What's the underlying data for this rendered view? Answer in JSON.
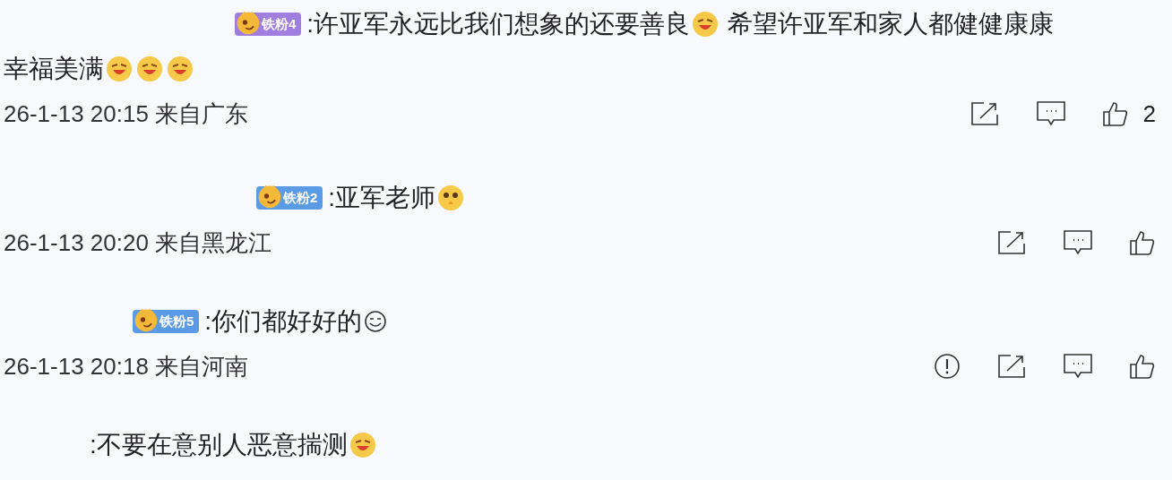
{
  "comments": [
    {
      "badge": {
        "text": "铁粉4",
        "color": "#a07ee0"
      },
      "lines": [
        [
          {
            "kind": "text",
            "text": ":许亚军永远比我们想象的还要善良"
          },
          {
            "kind": "emoji"
          },
          {
            "kind": "text",
            "text": "希望许亚军和家人都健健康康"
          }
        ],
        [
          {
            "kind": "text",
            "text": "幸福美满"
          },
          {
            "kind": "emoji"
          },
          {
            "kind": "emoji"
          },
          {
            "kind": "emoji"
          }
        ]
      ],
      "meta": "26-1-13 20:15 来自广东",
      "actions": [
        {
          "kind": "share"
        },
        {
          "kind": "comment"
        },
        {
          "kind": "like",
          "count": "2"
        }
      ]
    },
    {
      "badge": {
        "text": "铁粉2",
        "color": "#5b9be6"
      },
      "lines": [
        [
          {
            "kind": "text",
            "text": ":亚军老师"
          },
          {
            "kind": "emoji_pray"
          }
        ]
      ],
      "meta": "26-1-13 20:20 来自黑龙江",
      "actions": [
        {
          "kind": "share"
        },
        {
          "kind": "comment"
        },
        {
          "kind": "like"
        }
      ]
    },
    {
      "badge": {
        "text": "铁粉5",
        "color": "#5b9be6"
      },
      "lines": [
        [
          {
            "kind": "text",
            "text": ":你们都好好的"
          },
          {
            "kind": "emoji_smile"
          }
        ]
      ],
      "meta": "26-1-13 20:18 来自河南",
      "actions": [
        {
          "kind": "report"
        },
        {
          "kind": "share"
        },
        {
          "kind": "comment"
        },
        {
          "kind": "like"
        }
      ]
    },
    {
      "lines": [
        [
          {
            "kind": "text",
            "text": ":不要在意别人恶意揣测"
          },
          {
            "kind": "emoji"
          }
        ]
      ]
    }
  ]
}
